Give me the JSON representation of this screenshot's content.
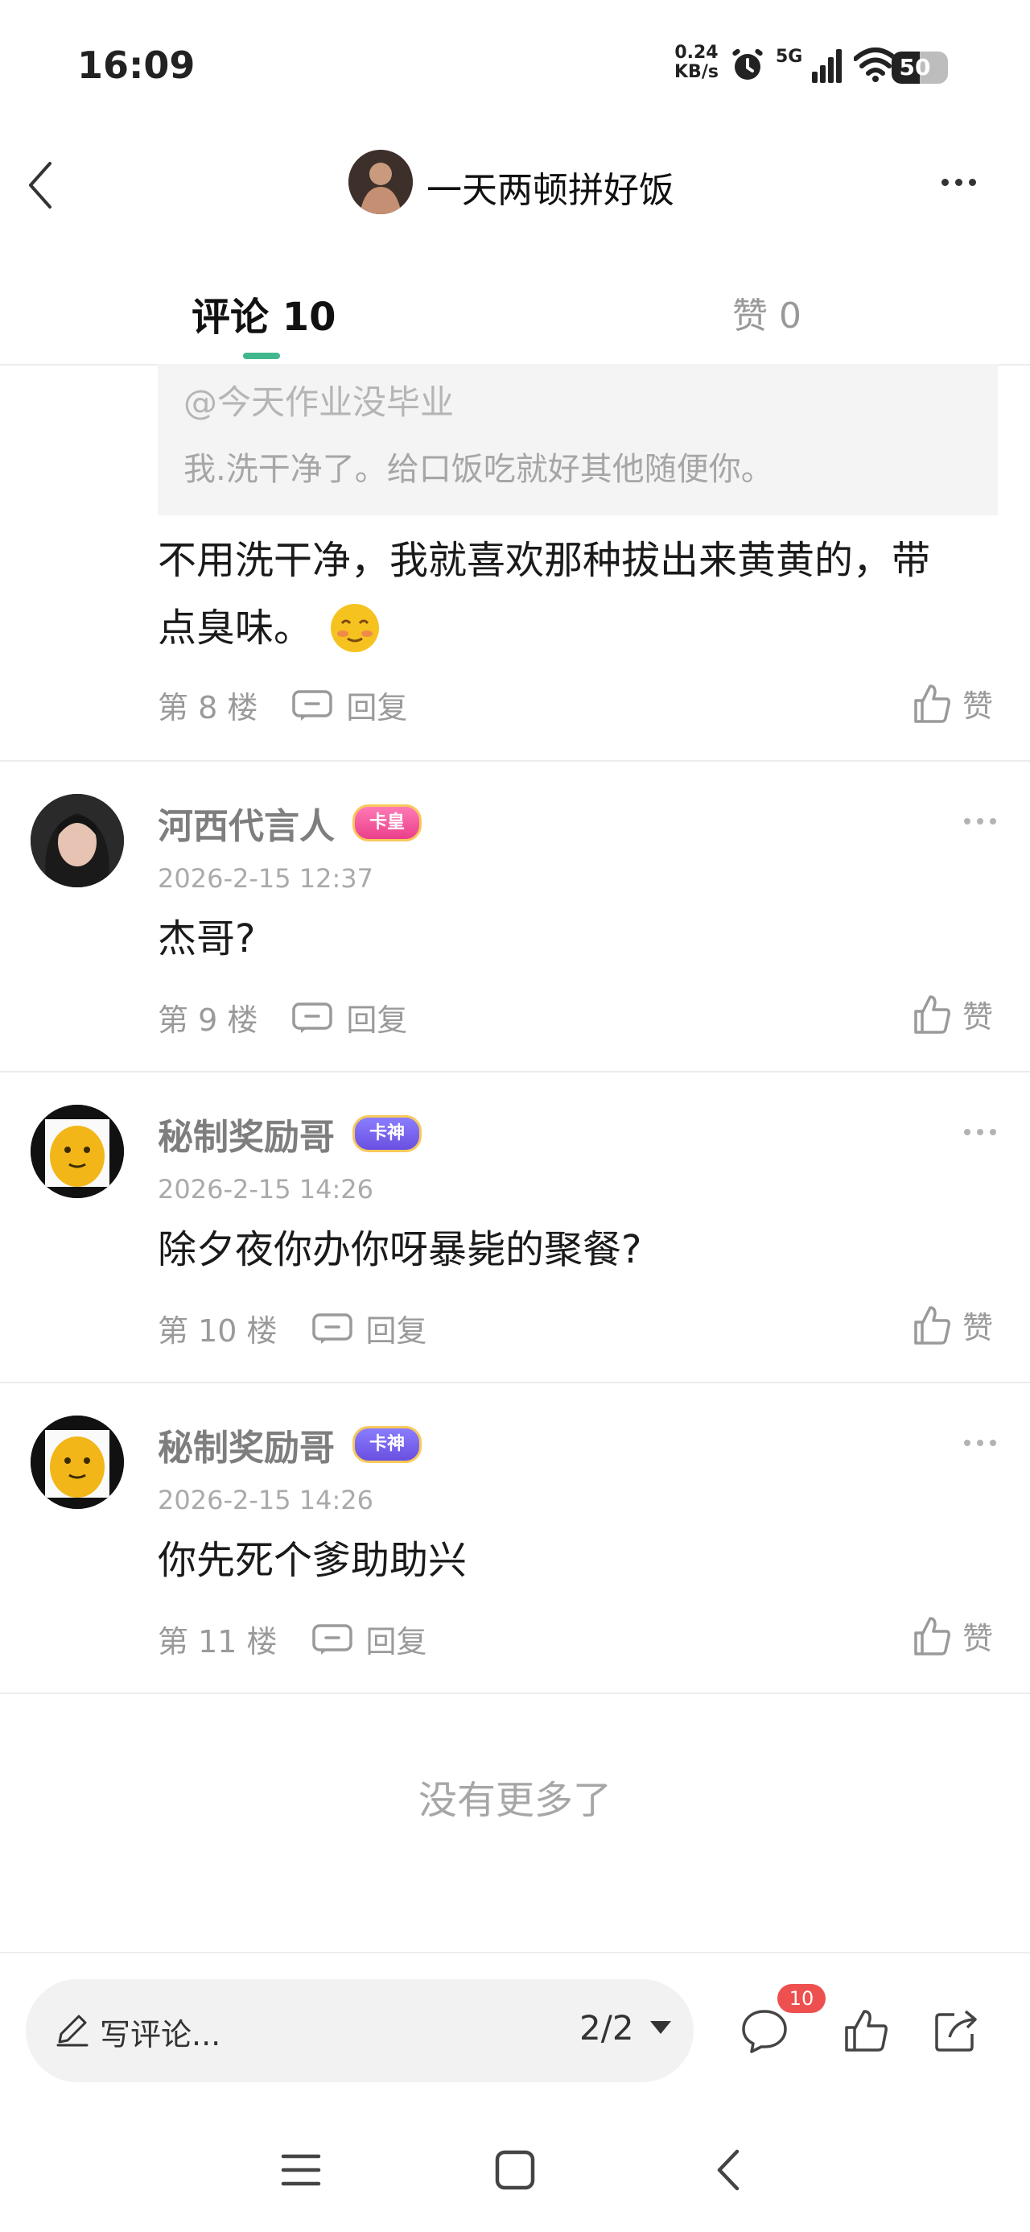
{
  "status_bar": {
    "time": "16:09",
    "net_speed_value": "0.24",
    "net_speed_unit": "KB/s",
    "cell_label": "5G",
    "battery": "50",
    "battery_fraction": 0.5
  },
  "header": {
    "back_icon": "chevron-left-icon",
    "title": "一天两顿拼好饭",
    "more_icon": "more-horizontal-icon"
  },
  "tabs": [
    {
      "label": "评论 10",
      "active": true
    },
    {
      "label": "赞 0",
      "active": false
    }
  ],
  "quoted": {
    "user": "@今天作业没毕业",
    "text": "我.洗干净了。给口饭吃就好其他随便你。"
  },
  "comments": [
    {
      "text_line1": "不用洗干净，我就喜欢那种拔出来黄黄的，带",
      "text_line2": "点臭味。",
      "floor": "第 8 楼",
      "reply": "回复",
      "like": "赞"
    },
    {
      "username": "河西代言人",
      "badge": "卡皇",
      "timestamp": "2026-2-15 12:37",
      "text": "杰哥?",
      "floor": "第 9 楼",
      "reply": "回复",
      "like": "赞"
    },
    {
      "username": "秘制奖励哥",
      "badge": "卡神",
      "timestamp": "2026-2-15 14:26",
      "text": "除夕夜你办你呀暴毙的聚餐?",
      "floor": "第 10 楼",
      "reply": "回复",
      "like": "赞"
    },
    {
      "username": "秘制奖励哥",
      "badge": "卡神",
      "timestamp": "2026-2-15 14:26",
      "text": "你先死个爹助助兴",
      "floor": "第 11 楼",
      "reply": "回复",
      "like": "赞"
    }
  ],
  "footer_note": "没有更多了",
  "bottom_bar": {
    "placeholder": "写评论...",
    "page": "2/2",
    "comment_count": "10"
  },
  "colors": {
    "accent": "#41b88e",
    "badge_red": "#ee4f4f"
  }
}
